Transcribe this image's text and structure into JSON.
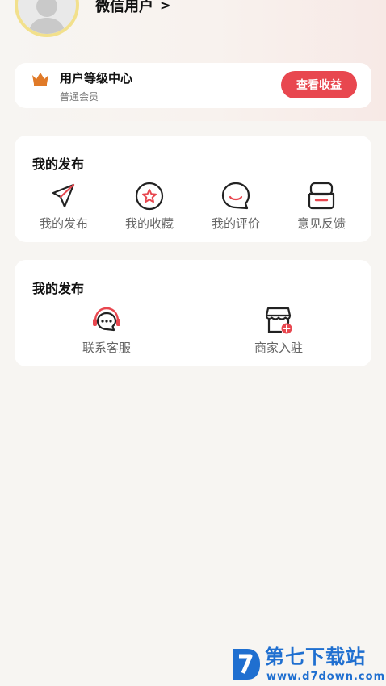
{
  "profile": {
    "username": "微信用户",
    "chevron": ">"
  },
  "level": {
    "title": "用户等级中心",
    "subtitle": "普通会员",
    "button_label": "查看收益"
  },
  "publish_section": {
    "title": "我的发布",
    "items": [
      {
        "label": "我的发布",
        "icon": "send-icon"
      },
      {
        "label": "我的收藏",
        "icon": "star-circle-icon"
      },
      {
        "label": "我的评价",
        "icon": "smile-chat-icon"
      },
      {
        "label": "意见反馈",
        "icon": "feedback-box-icon"
      }
    ]
  },
  "services_section": {
    "title": "我的发布",
    "items": [
      {
        "label": "联系客服",
        "icon": "headset-chat-icon"
      },
      {
        "label": "商家入驻",
        "icon": "store-add-icon"
      }
    ]
  },
  "watermark": {
    "cn": "第七下载站",
    "url": "www.d7down.com"
  },
  "colors": {
    "accent": "#e8474f",
    "crown": "#e07a28",
    "avatar_ring": "#f2e08c",
    "watermark": "#1f6fd0"
  }
}
